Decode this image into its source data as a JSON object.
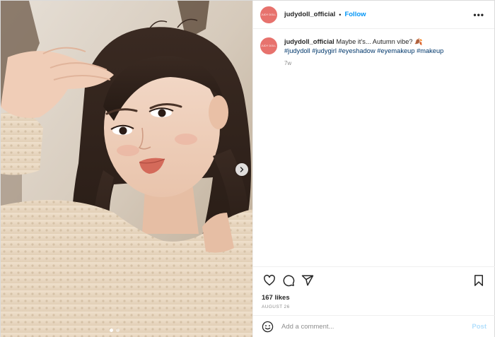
{
  "post": {
    "account": {
      "username": "judydoll_official",
      "avatar_text": "JUDY DOLL",
      "follow_label": "Follow",
      "separator": "•",
      "more_label": "•••"
    },
    "caption": {
      "username": "judydoll_official",
      "text": "Maybe it's... Autumn vibe? 🍂",
      "hashtags": "#judydoll #judygirl #eyeshadow #eyemakeup #makeup",
      "time_ago": "7w"
    },
    "actions": {
      "icons": [
        "heart-icon",
        "comment-icon",
        "share-icon",
        "bookmark-icon"
      ]
    },
    "likes": "167 likes",
    "date": "AUGUST 26",
    "comment": {
      "placeholder": "Add a comment...",
      "post_label": "Post"
    },
    "media": {
      "carousel_count": 2,
      "active_index": 0
    }
  },
  "colors": {
    "accent": "#0095f6",
    "hashtag": "#00376b",
    "avatar": "#e7726d",
    "muted": "#8e8e8e",
    "post_disabled": "#b2dffc"
  }
}
